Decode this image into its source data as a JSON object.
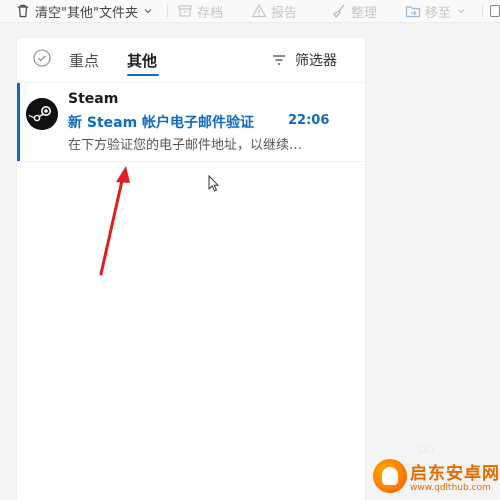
{
  "toolbar": {
    "empty_folder_label": "清空\"其他\"文件夹",
    "archive_label": "存档",
    "report_label": "报告",
    "sweep_label": "整理",
    "move_label": "移至"
  },
  "pivots": {
    "focused_label": "重点",
    "other_label": "其他",
    "filter_label": "筛选器"
  },
  "messages": [
    {
      "sender": "Steam",
      "subject": "新 Steam 帐户电子邮件验证",
      "time": "22:06",
      "preview": "在下方验证您的电子邮件地址，以继续…"
    }
  ],
  "watermark": {
    "name": "启东安卓网",
    "url": "www.qdlthub.com"
  },
  "colors": {
    "accent": "#0f6cbd",
    "annotation_arrow": "#e02020",
    "watermark": "#e76a00"
  },
  "icons": [
    "trash-icon",
    "archive-icon",
    "warning-icon",
    "broom-icon",
    "move-folder-icon",
    "checkmark-circle-icon",
    "filter-icon",
    "steam-logo",
    "mouse-pointer-icon"
  ]
}
